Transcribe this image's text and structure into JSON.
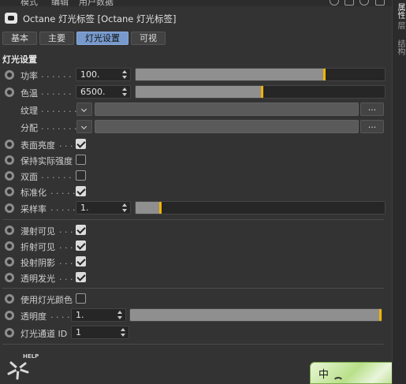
{
  "menubar": {
    "items": [
      "模式",
      "编辑",
      "用户数据"
    ]
  },
  "header": {
    "title": "Octane 灯光标签 [Octane 灯光标签]"
  },
  "tabs": [
    {
      "label": "基本"
    },
    {
      "label": "主要"
    },
    {
      "label": "灯光设置",
      "active": true
    },
    {
      "label": "可视"
    }
  ],
  "section": {
    "title": "灯光设置"
  },
  "params": {
    "power": {
      "label": "功率",
      "dots": ". . . . . .",
      "value": "100.",
      "level": 0.76
    },
    "temperature": {
      "label": "色温",
      "dots": ". . . . . .",
      "value": "6500.",
      "level": 0.51
    },
    "texture": {
      "label": "纹理",
      "dots": ". . . . . . .",
      "button": "..."
    },
    "distribution": {
      "label": "分配",
      "dots": ". . . . . . .",
      "button": "..."
    },
    "surface_brightness": {
      "label": "表面亮度",
      "dots": ". . .",
      "checked": true
    },
    "keep_intensity": {
      "label": "保持实际强度",
      "checked": false
    },
    "double_sided": {
      "label": "双面",
      "dots": ". . . . . .",
      "checked": false
    },
    "normalize": {
      "label": "标准化",
      "dots": ". . . . .",
      "checked": true
    },
    "sample_rate": {
      "label": "采样率",
      "dots": ". . . . .",
      "value": "1.",
      "level": 0.1
    },
    "diffuse_visible": {
      "label": "漫射可见",
      "dots": ". . .",
      "checked": true
    },
    "refraction_visible": {
      "label": "折射可见",
      "dots": ". . .",
      "checked": true
    },
    "cast_shadows": {
      "label": "投射阴影",
      "dots": ". . .",
      "checked": true
    },
    "transparent_emission": {
      "label": "透明发光",
      "dots": ". . .",
      "checked": true
    },
    "use_light_color": {
      "label": "使用灯光颜色",
      "checked": false
    },
    "opacity": {
      "label": "透明度",
      "dots": ". . . .",
      "value": "1.",
      "level": 1.0
    },
    "light_pass_id": {
      "label": "灯光通道 ID",
      "value": "1"
    }
  },
  "help": {
    "label": "HELP"
  },
  "ime": {
    "char": "中"
  },
  "rightpanel": {
    "tabs": [
      "属性",
      "层",
      "结构"
    ]
  },
  "colors": {
    "accent": "#f1b400",
    "active_tab": "#7799cc",
    "background": "#333333"
  }
}
